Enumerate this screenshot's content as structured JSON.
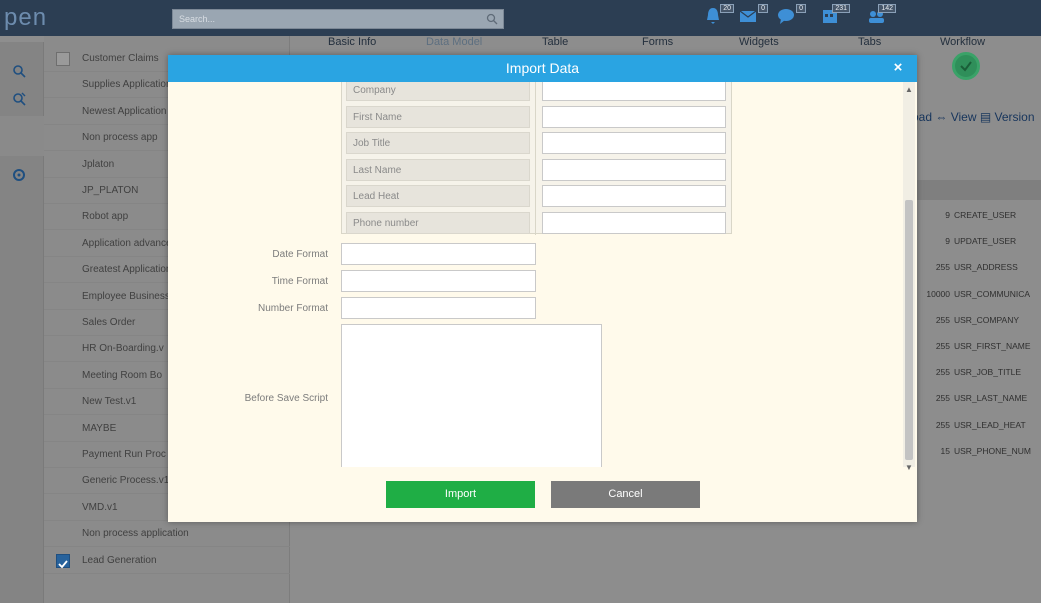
{
  "app": {
    "logo_text": "pen",
    "search_placeholder": "Search..."
  },
  "notifications": [
    {
      "icon": "bell-icon",
      "count": "20"
    },
    {
      "icon": "mail-icon",
      "count": "0"
    },
    {
      "icon": "chat-icon",
      "count": "0"
    },
    {
      "icon": "calendar-icon",
      "count": "231"
    },
    {
      "icon": "group-icon",
      "count": "142"
    }
  ],
  "tabs": [
    {
      "label": "Basic Info"
    },
    {
      "label": "Data Model"
    },
    {
      "label": "Table"
    },
    {
      "label": "Forms"
    },
    {
      "label": "Widgets"
    },
    {
      "label": "Tabs"
    },
    {
      "label": "Workflow"
    }
  ],
  "applications": [
    {
      "label": "Customer Claims",
      "checked": false
    },
    {
      "label": "Supplies Application"
    },
    {
      "label": "Newest Application"
    },
    {
      "label": "Non process app"
    },
    {
      "label": "Jplaton"
    },
    {
      "label": "JP_PLATON"
    },
    {
      "label": "Robot app"
    },
    {
      "label": "Application advanced"
    },
    {
      "label": "Greatest Application"
    },
    {
      "label": "Employee Business"
    },
    {
      "label": "Sales Order"
    },
    {
      "label": "HR On-Boarding.v"
    },
    {
      "label": "Meeting Room Bo"
    },
    {
      "label": "New Test.v1"
    },
    {
      "label": "MAYBE"
    },
    {
      "label": "Payment Run Proc"
    },
    {
      "label": "Generic Process.v1"
    },
    {
      "label": "VMD.v1"
    },
    {
      "label": "Non process application"
    },
    {
      "label": "Lead Generation",
      "checked": true
    }
  ],
  "toolbar": {
    "links_text": "oad ⇔ View ▤ Version"
  },
  "fields": [
    {
      "length": "9",
      "name": "CREATE_USER"
    },
    {
      "length": "9",
      "name": "UPDATE_USER"
    },
    {
      "length": "255",
      "name": "USR_ADDRESS"
    },
    {
      "length": "10000",
      "name": "USR_COMMUNICA"
    },
    {
      "length": "255",
      "name": "USR_COMPANY"
    },
    {
      "length": "255",
      "name": "USR_FIRST_NAME"
    },
    {
      "length": "255",
      "name": "USR_JOB_TITLE"
    },
    {
      "length": "255",
      "name": "USR_LAST_NAME"
    },
    {
      "length": "255",
      "name": "USR_LEAD_HEAT"
    },
    {
      "length": "15",
      "name": "USR_PHONE_NUM"
    }
  ],
  "modal": {
    "title": "Import Data",
    "close_glyph": "×",
    "mapping_fields": [
      {
        "label": "Company",
        "value": ""
      },
      {
        "label": "First Name",
        "value": ""
      },
      {
        "label": "Job Title",
        "value": ""
      },
      {
        "label": "Last Name",
        "value": ""
      },
      {
        "label": "Lead Heat",
        "value": ""
      },
      {
        "label": "Phone number",
        "value": ""
      }
    ],
    "date_format_label": "Date Format",
    "date_format_value": "",
    "time_format_label": "Time Format",
    "time_format_value": "",
    "number_format_label": "Number Format",
    "number_format_value": "",
    "before_save_script_label": "Before Save Script",
    "before_save_script_value": "",
    "import_label": "Import",
    "cancel_label": "Cancel",
    "scroll_up_glyph": "▲",
    "scroll_down_glyph": "▼"
  },
  "colors": {
    "modal_header": "#2aa4e2",
    "modal_body": "#fffaeb",
    "import_button": "#1fae45",
    "cancel_button": "#7a7a7a"
  }
}
